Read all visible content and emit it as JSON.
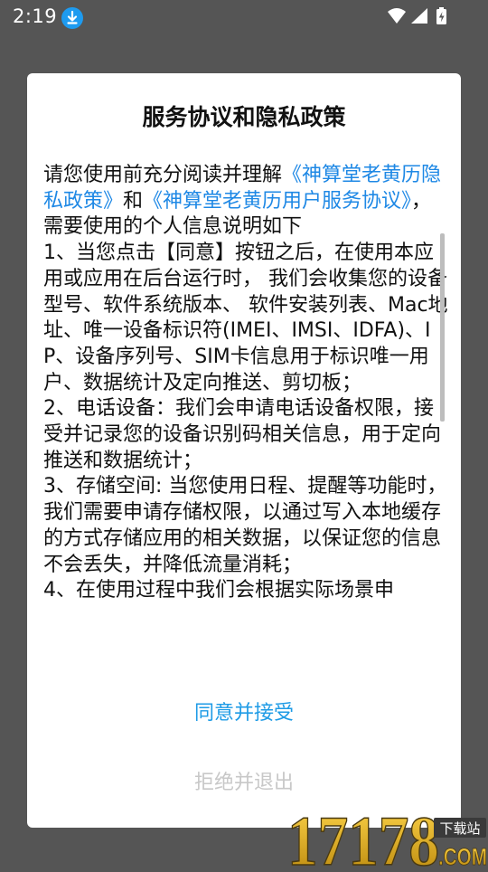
{
  "status_bar": {
    "time": "2:19",
    "download_icon": "download-icon",
    "wifi_icon": "wifi-icon",
    "signal_icon": "signal-icon",
    "battery_icon": "battery-charging-icon"
  },
  "dialog": {
    "title": "服务协议和隐私政策",
    "intro_prefix": "请您使用前充分阅读并理解",
    "privacy_link": "《神算堂老黄历隐私政策》",
    "and_text": "和",
    "service_link": "《神算堂老黄历用户服务协议》",
    "intro_suffix": "，需要使用的个人信息说明如下",
    "item1": "1、当您点击【同意】按钮之后，在使用本应用或应用在后台运行时， 我们会收集您的设备型号、软件系统版本、 软件安装列表、Mac地址、唯一设备标识符(IMEI、IMSI、IDFA)、IP、设备序列号、SIM卡信息用于标识唯一用户、数据统计及定向推送、剪切板；",
    "item2": "2、电话设备：我们会申请电话设备权限，接受并记录您的设备识别码相关信息，用于定向推送和数据统计；",
    "item3": "3、存储空间: 当您使用日程、提醒等功能时，我们需要申请存储权限，以通过写入本地缓存的方式存储应用的相关数据，以保证您的信息不会丢失，并降低流量消耗；",
    "item4": "4、在使用过程中我们会根据实际场景申",
    "accept_button": "同意并接受",
    "refuse_button": "拒绝并退出"
  },
  "watermark": {
    "number": "17178",
    "site": ".COM",
    "badge": "下载站"
  },
  "colors": {
    "link": "#1e88e5",
    "accept": "#1e9be6",
    "refuse": "#c8c8c8",
    "backdrop": "#555555"
  }
}
